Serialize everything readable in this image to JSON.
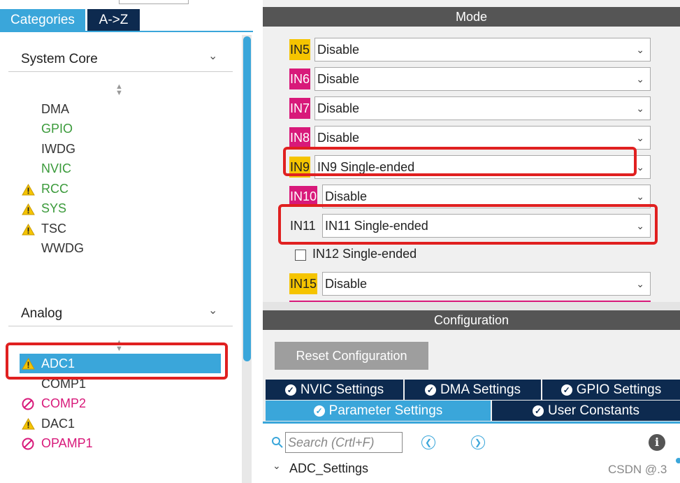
{
  "left": {
    "tabs": [
      "Categories",
      "A->Z"
    ],
    "system_core": {
      "title": "System Core",
      "items": [
        "DMA",
        "GPIO",
        "IWDG",
        "NVIC",
        "RCC",
        "SYS",
        "TSC",
        "WWDG"
      ]
    },
    "analog": {
      "title": "Analog",
      "items": [
        "ADC1",
        "COMP1",
        "COMP2",
        "DAC1",
        "OPAMP1"
      ]
    }
  },
  "right": {
    "mode_title": "Mode",
    "channels": [
      {
        "label": "IN5",
        "value": "Disable"
      },
      {
        "label": "IN6",
        "value": "Disable"
      },
      {
        "label": "IN7",
        "value": "Disable"
      },
      {
        "label": "IN8",
        "value": "Disable"
      },
      {
        "label": "IN9",
        "value": "IN9 Single-ended"
      },
      {
        "label": "IN10",
        "value": "Disable"
      },
      {
        "label": "IN11",
        "value": "IN11 Single-ended"
      },
      {
        "label": "IN15",
        "value": "Disable"
      }
    ],
    "in12_checkbox": "IN12 Single-ended",
    "config_title": "Configuration",
    "reset_label": "Reset Configuration",
    "tabs_row1": [
      "NVIC Settings",
      "DMA Settings",
      "GPIO Settings"
    ],
    "tabs_row2": [
      "Parameter Settings",
      "User Constants"
    ],
    "search_placeholder": "Search (Crtl+F)",
    "tree_root": "ADC_Settings",
    "watermark": "CSDN @.3"
  },
  "colors": {
    "accent": "#3aa6da",
    "navy": "#0d2a4f",
    "yellow": "#f5c400",
    "pink": "#d8197a",
    "green": "#3a9a3a",
    "highlight_red": "#e02020"
  }
}
